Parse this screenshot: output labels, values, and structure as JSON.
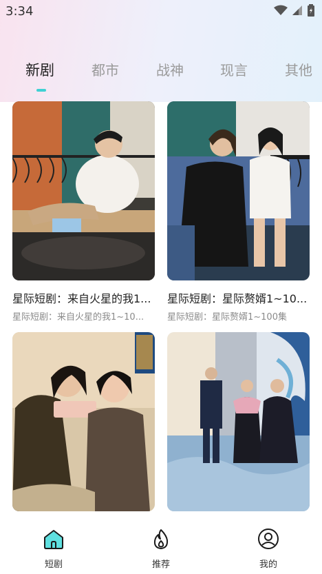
{
  "status_bar": {
    "time": "3:34"
  },
  "tabs": [
    {
      "label": "新剧",
      "active": true
    },
    {
      "label": "都市",
      "active": false
    },
    {
      "label": "战神",
      "active": false
    },
    {
      "label": "现言",
      "active": false
    },
    {
      "label": "其他",
      "active": false
    }
  ],
  "cards": [
    {
      "title": "星际短剧：来自火星的我1...",
      "subtitle": "星际短剧：来自火星的我1~10..."
    },
    {
      "title": "星际短剧：星际赘婿1~10...",
      "subtitle": "星际短剧：星际赘婿1~100集"
    },
    {
      "title": "",
      "subtitle": ""
    },
    {
      "title": "",
      "subtitle": ""
    }
  ],
  "bottom_nav": [
    {
      "label": "短剧",
      "icon": "home-icon",
      "active": true
    },
    {
      "label": "推荐",
      "icon": "flame-icon",
      "active": false
    },
    {
      "label": "我的",
      "icon": "user-icon",
      "active": false
    }
  ],
  "colors": {
    "accent": "#3fd1d3",
    "active_text": "#222222",
    "inactive_text": "#9a9a9a"
  }
}
